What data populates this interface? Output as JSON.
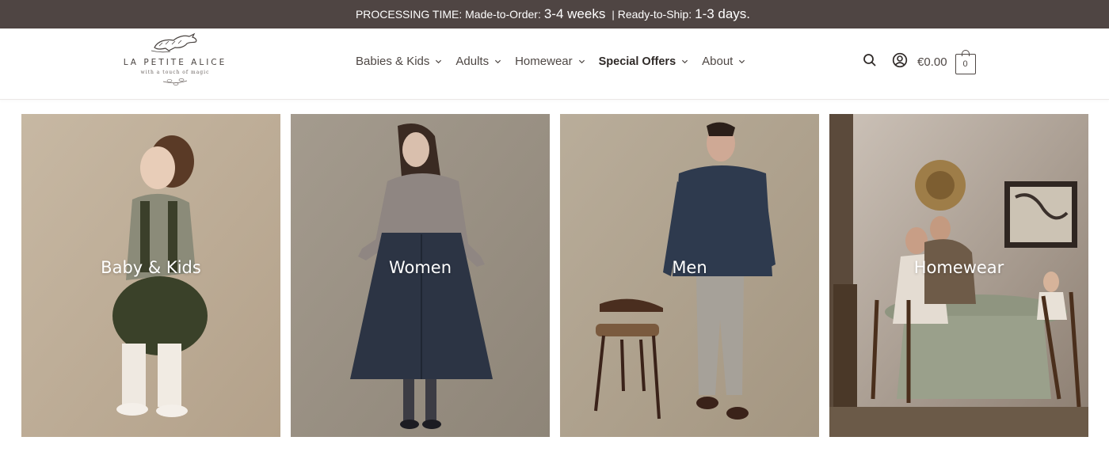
{
  "announcement": {
    "prefix": "PROCESSING TIME: Made-to-Order:",
    "made_to_order": "3-4 weeks",
    "separator": "|",
    "ready_label": "Ready-to-Ship:",
    "ready_to_ship": "1-3 days."
  },
  "logo": {
    "name": "LA PETITE ALICE",
    "tagline": "with a touch of magic"
  },
  "nav": {
    "items": [
      {
        "label": "Babies & Kids",
        "icon": "chevron-down-icon"
      },
      {
        "label": "Adults",
        "icon": "chevron-down-icon"
      },
      {
        "label": "Homewear",
        "icon": "chevron-down-icon"
      },
      {
        "label": "Special Offers",
        "icon": "chevron-down-icon"
      },
      {
        "label": "About",
        "icon": "chevron-down-icon"
      }
    ]
  },
  "tools": {
    "search_icon": "search-icon",
    "account_icon": "user-circle-icon",
    "cart_total": "€0.00",
    "cart_count": "0"
  },
  "categories": [
    {
      "label": "Baby & Kids"
    },
    {
      "label": "Women"
    },
    {
      "label": "Men"
    },
    {
      "label": "Homewear"
    }
  ],
  "colors": {
    "topbar_bg": "#4f4543",
    "topbar_text": "#ffffff",
    "nav_text": "#4e4744",
    "tile_label": "#ffffff"
  }
}
